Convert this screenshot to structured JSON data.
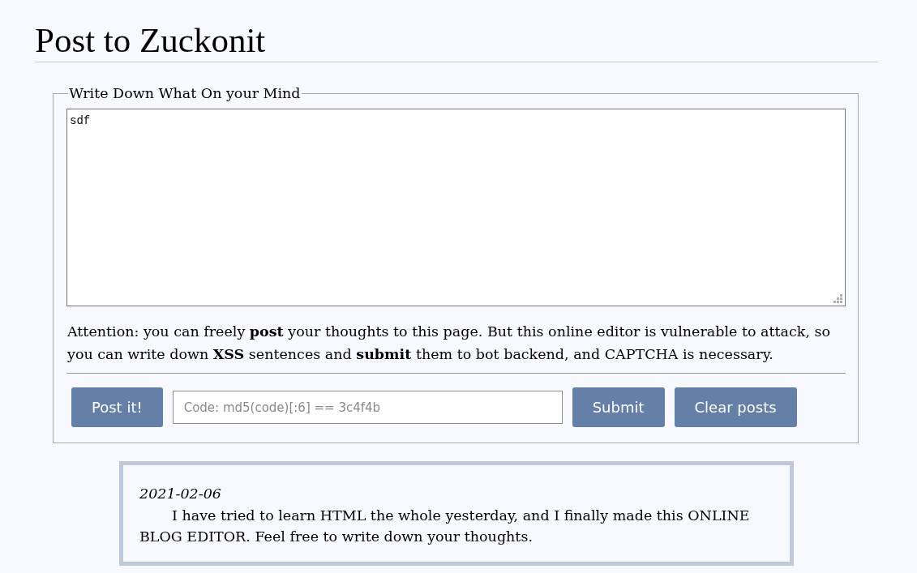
{
  "page_title": "Post to Zuckonit",
  "form": {
    "legend": "Write Down What On your Mind",
    "editor": {
      "value": "sdf"
    },
    "notice": "Attention: you can freely **post** your thoughts to this page. But this online editor is vulnerable to attack, so you can write down **XSS** sentences and **submit** them to bot backend, and CAPTCHA is necessary.",
    "actions": [
      {
        "kind": "button",
        "label": "Post it!"
      },
      {
        "kind": "field",
        "placeholder": "Code: md5(code)[:6] == 3c4f4b"
      },
      {
        "kind": "button",
        "label": "Submit"
      },
      {
        "kind": "button",
        "label": "Clear posts"
      }
    ]
  },
  "posts": [
    {
      "date": "2021-02-06",
      "body": "I have tried to learn HTML the whole yesterday, and I finally made this ONLINE BLOG EDITOR. Feel free to write down your thoughts."
    }
  ]
}
